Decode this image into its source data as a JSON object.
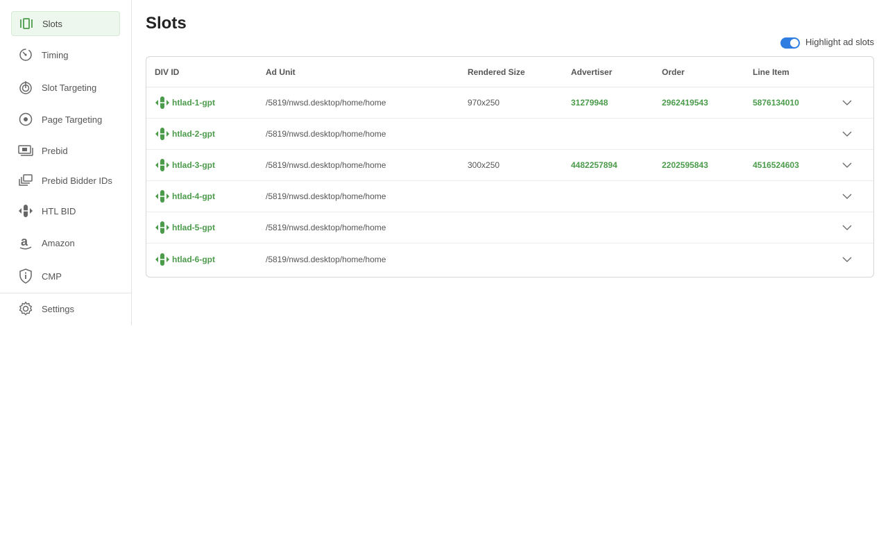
{
  "sidebar": {
    "items": [
      {
        "label": "Slots",
        "icon": "slots-icon"
      },
      {
        "label": "Timing",
        "icon": "timing-icon"
      },
      {
        "label": "Slot Targeting",
        "icon": "slot-targeting-icon"
      },
      {
        "label": "Page Targeting",
        "icon": "page-targeting-icon"
      },
      {
        "label": "Prebid",
        "icon": "prebid-icon"
      },
      {
        "label": "Prebid Bidder IDs",
        "icon": "prebid-bidder-ids-icon"
      },
      {
        "label": "HTL BID",
        "icon": "htl-bid-icon"
      },
      {
        "label": "Amazon",
        "icon": "amazon-icon"
      },
      {
        "label": "CMP",
        "icon": "cmp-shield-icon"
      },
      {
        "label": "Settings",
        "icon": "gear-icon"
      }
    ]
  },
  "page": {
    "title": "Slots"
  },
  "toggle": {
    "label": "Highlight ad slots",
    "on": true
  },
  "colors": {
    "accent_green": "#4b9b4b",
    "toggle_blue": "#2f7de1"
  },
  "table": {
    "headers": [
      "DIV ID",
      "Ad Unit",
      "Rendered Size",
      "Advertiser",
      "Order",
      "Line Item"
    ],
    "rows": [
      {
        "div_id": "htlad-1-gpt",
        "ad_unit": "/5819/nwsd.desktop/home/home",
        "size": "970x250",
        "advertiser": "31279948",
        "order": "2962419543",
        "line_item": "5876134010"
      },
      {
        "div_id": "htlad-2-gpt",
        "ad_unit": "/5819/nwsd.desktop/home/home",
        "size": "",
        "advertiser": "",
        "order": "",
        "line_item": ""
      },
      {
        "div_id": "htlad-3-gpt",
        "ad_unit": "/5819/nwsd.desktop/home/home",
        "size": "300x250",
        "advertiser": "4482257894",
        "order": "2202595843",
        "line_item": "4516524603"
      },
      {
        "div_id": "htlad-4-gpt",
        "ad_unit": "/5819/nwsd.desktop/home/home",
        "size": "",
        "advertiser": "",
        "order": "",
        "line_item": ""
      },
      {
        "div_id": "htlad-5-gpt",
        "ad_unit": "/5819/nwsd.desktop/home/home",
        "size": "",
        "advertiser": "",
        "order": "",
        "line_item": ""
      },
      {
        "div_id": "htlad-6-gpt",
        "ad_unit": "/5819/nwsd.desktop/home/home",
        "size": "",
        "advertiser": "",
        "order": "",
        "line_item": ""
      }
    ]
  }
}
